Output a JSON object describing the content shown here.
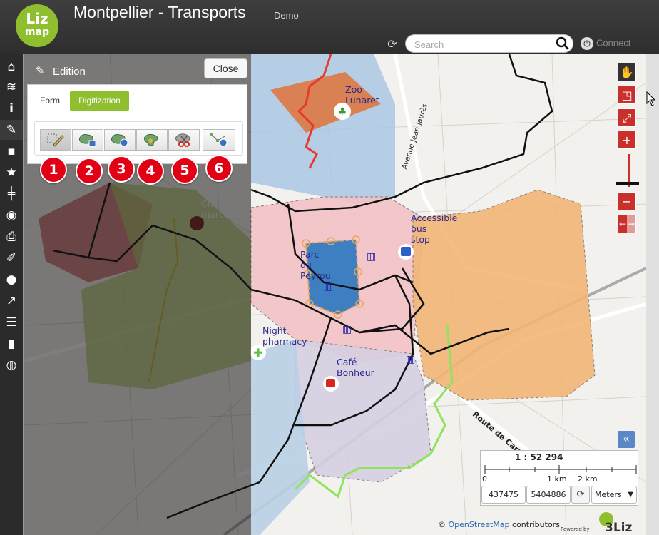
{
  "header": {
    "logo_top": "Liz",
    "logo_bottom": "map",
    "title": "Montpellier - Transports",
    "subtitle": "Demo",
    "search_placeholder": "Search",
    "connect_label": "Connect"
  },
  "sidebar": {
    "items": [
      {
        "name": "home-icon",
        "glyph": "⌂"
      },
      {
        "name": "layers-icon",
        "glyph": "≋"
      },
      {
        "name": "info-icon",
        "glyph": "i"
      },
      {
        "name": "edition-icon",
        "glyph": "✎"
      },
      {
        "name": "comment-icon",
        "glyph": "▪"
      },
      {
        "name": "star-icon",
        "glyph": "★"
      },
      {
        "name": "signpost-icon",
        "glyph": "┼"
      },
      {
        "name": "locate-icon",
        "glyph": "◉"
      },
      {
        "name": "print-icon",
        "glyph": "⎙"
      },
      {
        "name": "measure-icon",
        "glyph": "╱"
      },
      {
        "name": "chat-icon",
        "glyph": "●"
      },
      {
        "name": "share-icon",
        "glyph": "↗"
      },
      {
        "name": "list-icon",
        "glyph": "☰"
      },
      {
        "name": "chart-icon",
        "glyph": "▮"
      },
      {
        "name": "globe-icon",
        "glyph": "◍"
      }
    ]
  },
  "edition": {
    "title": "Edition",
    "close_label": "Close",
    "tabs": {
      "form": "Form",
      "digitization": "Digitization"
    },
    "badges": [
      "1",
      "2",
      "3",
      "4",
      "5",
      "6"
    ]
  },
  "map": {
    "labels": {
      "zoo": "Zoo\nLunaret",
      "chez_marcel": "Chez\nmarcel",
      "accessible_bus": "Accessible\nbus\nstop",
      "parc_peyrou": "Parc\ndu\nPeyrou",
      "night_pharmacy": "Night\npharmacy",
      "cafe_bonheur": "Café\nBonheur",
      "avenue": "Avenue Jean Jaurès",
      "route_carnon": "Route de Carnon"
    },
    "colors": {
      "accent_green": "#8fbe2e",
      "control_red": "#c9302c",
      "badge_red": "#e10014"
    }
  },
  "scale": {
    "value": "1 : 52 294",
    "ticks": [
      "0",
      "1 km",
      "2 km"
    ],
    "coord_x": "437475",
    "coord_y": "5404886",
    "units": "Meters"
  },
  "footer": {
    "attribution_prefix": "©",
    "attribution_osm": "OpenStreetMap",
    "attribution_suffix": "contributors",
    "powered_by": "Powered by",
    "powered_brand": "3Liz"
  }
}
